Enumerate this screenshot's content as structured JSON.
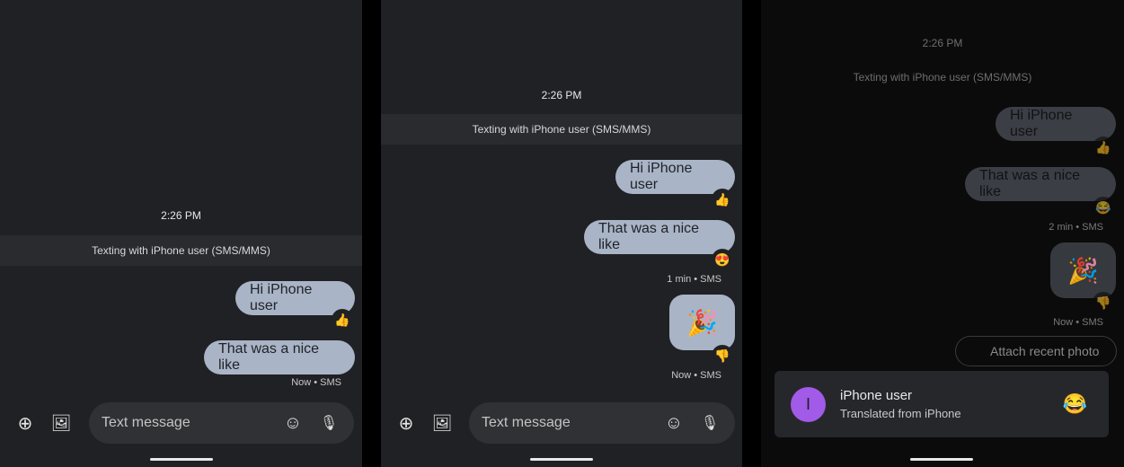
{
  "time": "2:26 PM",
  "banner": "Texting with iPhone user (SMS/MMS)",
  "messages": {
    "m1": "Hi iPhone user",
    "m2": "That was a nice like"
  },
  "reactions": {
    "thumbs_up": "👍",
    "heart_eyes": "😍",
    "laugh": "😂",
    "thumbs_down": "👎",
    "party": "🎉"
  },
  "meta": {
    "now": "Now • SMS",
    "one_min": "1 min • SMS",
    "two_min": "2 min • SMS"
  },
  "composer": {
    "placeholder": "Text message",
    "plus_icon": "⊕",
    "gallery_icon": "🖼",
    "emoji_icon": "☺",
    "mic_icon": "🎙"
  },
  "chip": {
    "label": "Attach recent photo"
  },
  "notification": {
    "avatar_letter": "I",
    "title": "iPhone user",
    "subtitle": "Translated from iPhone",
    "emoji": "😂",
    "avatar_color": "#a25ae8"
  }
}
